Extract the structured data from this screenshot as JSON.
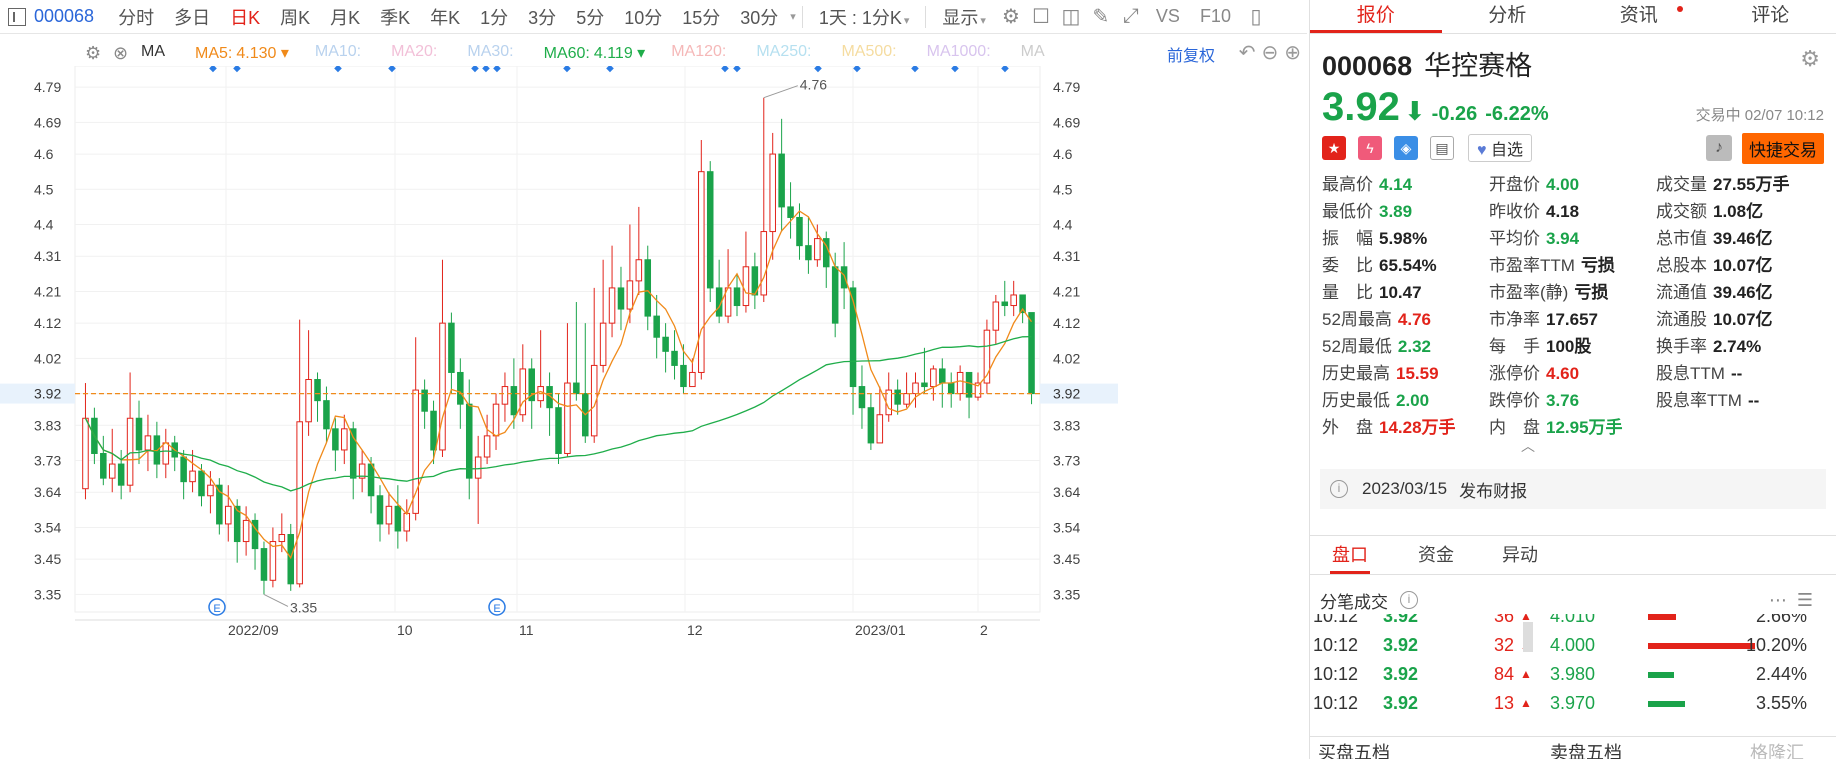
{
  "toolbar": {
    "code": "000068",
    "periods": [
      "分时",
      "多日",
      "日K",
      "周K",
      "月K",
      "季K",
      "年K",
      "1分",
      "3分",
      "5分",
      "10分",
      "15分",
      "30分"
    ],
    "active_period": "日K",
    "range": "1天 : 1分K",
    "display": "显示",
    "vs": "VS",
    "f10": "F10"
  },
  "mabar": {
    "ma_items": [
      {
        "label": "MA",
        "value": "",
        "color": "#333333"
      },
      {
        "label": "MA5:",
        "value": "4.130 ▾",
        "color": "#f08a1a"
      },
      {
        "label": "MA10:",
        "value": "",
        "color": "#b9d2ee"
      },
      {
        "label": "MA20:",
        "value": "",
        "color": "#f2c0d8"
      },
      {
        "label": "MA30:",
        "value": "",
        "color": "#b9d2ee"
      },
      {
        "label": "MA60:",
        "value": "4.119 ▾",
        "color": "#1fad4a"
      },
      {
        "label": "MA120:",
        "value": "",
        "color": "#f5b8b8"
      },
      {
        "label": "MA250:",
        "value": "",
        "color": "#b6e0f0"
      },
      {
        "label": "MA500:",
        "value": "",
        "color": "#f5dca0"
      },
      {
        "label": "MA1000:",
        "value": "",
        "color": "#d8c4ee"
      },
      {
        "label": "MA",
        "value": "",
        "color": "#cccccc"
      }
    ],
    "adjust": "前复权"
  },
  "chart_data": {
    "type": "candlestick",
    "x_labels": [
      "2022/09",
      "10",
      "11",
      "12",
      "2023/01",
      "2"
    ],
    "y_ticks": [
      4.79,
      4.69,
      4.6,
      4.5,
      4.4,
      4.31,
      4.21,
      4.12,
      4.02,
      3.92,
      3.83,
      3.73,
      3.64,
      3.54,
      3.45,
      3.35
    ],
    "ylim": [
      3.3,
      4.85
    ],
    "current_price": 3.92,
    "max_label": "4.76",
    "min_label": "3.35",
    "event_marker": "E",
    "candles": [
      [
        3.65,
        3.85,
        3.95,
        3.62
      ],
      [
        3.85,
        3.75,
        3.88,
        3.72
      ],
      [
        3.75,
        3.68,
        3.8,
        3.66
      ],
      [
        3.68,
        3.72,
        3.82,
        3.64
      ],
      [
        3.72,
        3.66,
        3.76,
        3.62
      ],
      [
        3.66,
        3.85,
        3.98,
        3.64
      ],
      [
        3.85,
        3.76,
        3.9,
        3.72
      ],
      [
        3.76,
        3.8,
        3.86,
        3.7
      ],
      [
        3.8,
        3.72,
        3.84,
        3.68
      ],
      [
        3.72,
        3.78,
        3.82,
        3.68
      ],
      [
        3.78,
        3.74,
        3.8,
        3.7
      ],
      [
        3.74,
        3.67,
        3.76,
        3.62
      ],
      [
        3.67,
        3.7,
        3.76,
        3.64
      ],
      [
        3.7,
        3.63,
        3.72,
        3.6
      ],
      [
        3.63,
        3.66,
        3.7,
        3.58
      ],
      [
        3.66,
        3.55,
        3.68,
        3.52
      ],
      [
        3.55,
        3.6,
        3.66,
        3.5
      ],
      [
        3.6,
        3.5,
        3.62,
        3.44
      ],
      [
        3.5,
        3.56,
        3.6,
        3.46
      ],
      [
        3.56,
        3.48,
        3.58,
        3.42
      ],
      [
        3.48,
        3.39,
        3.5,
        3.35
      ],
      [
        3.39,
        3.5,
        3.54,
        3.37
      ],
      [
        3.5,
        3.52,
        3.58,
        3.47
      ],
      [
        3.52,
        3.38,
        3.55,
        3.36
      ],
      [
        3.38,
        3.84,
        4.13,
        3.37
      ],
      [
        3.84,
        3.96,
        4.1,
        3.8
      ],
      [
        3.96,
        3.9,
        3.98,
        3.84
      ],
      [
        3.9,
        3.82,
        3.94,
        3.78
      ],
      [
        3.82,
        3.76,
        3.85,
        3.7
      ],
      [
        3.76,
        3.82,
        3.86,
        3.72
      ],
      [
        3.82,
        3.68,
        3.84,
        3.62
      ],
      [
        3.68,
        3.72,
        3.76,
        3.64
      ],
      [
        3.72,
        3.63,
        3.74,
        3.58
      ],
      [
        3.63,
        3.55,
        3.66,
        3.5
      ],
      [
        3.55,
        3.6,
        3.64,
        3.52
      ],
      [
        3.6,
        3.53,
        3.66,
        3.48
      ],
      [
        3.53,
        3.58,
        3.62,
        3.5
      ],
      [
        3.58,
        3.93,
        4.08,
        3.56
      ],
      [
        3.93,
        3.87,
        3.96,
        3.82
      ],
      [
        3.87,
        3.76,
        3.9,
        3.72
      ],
      [
        3.76,
        4.12,
        4.3,
        3.74
      ],
      [
        4.12,
        3.98,
        4.15,
        3.92
      ],
      [
        3.98,
        3.89,
        4.02,
        3.82
      ],
      [
        3.89,
        3.68,
        3.96,
        3.62
      ],
      [
        3.68,
        3.74,
        3.8,
        3.55
      ],
      [
        3.74,
        3.8,
        3.86,
        3.72
      ],
      [
        3.8,
        3.89,
        3.92,
        3.76
      ],
      [
        3.89,
        3.94,
        3.98,
        3.84
      ],
      [
        3.94,
        3.86,
        4.02,
        3.82
      ],
      [
        3.86,
        3.99,
        4.06,
        3.84
      ],
      [
        3.99,
        3.9,
        4.02,
        3.82
      ],
      [
        3.9,
        3.94,
        4.1,
        3.88
      ],
      [
        3.94,
        3.88,
        3.98,
        3.8
      ],
      [
        3.88,
        3.75,
        3.92,
        3.72
      ],
      [
        3.75,
        3.95,
        4.12,
        3.74
      ],
      [
        3.95,
        3.92,
        4.18,
        3.9
      ],
      [
        3.92,
        3.8,
        4.12,
        3.78
      ],
      [
        3.8,
        4.0,
        4.22,
        3.78
      ],
      [
        4.0,
        4.12,
        4.3,
        3.98
      ],
      [
        4.12,
        4.22,
        4.34,
        4.08
      ],
      [
        4.22,
        4.16,
        4.28,
        4.1
      ],
      [
        4.16,
        4.24,
        4.4,
        4.12
      ],
      [
        4.24,
        4.3,
        4.45,
        4.2
      ],
      [
        4.3,
        4.14,
        4.34,
        4.1
      ],
      [
        4.14,
        4.08,
        4.2,
        4.02
      ],
      [
        4.08,
        4.04,
        4.12,
        3.98
      ],
      [
        4.04,
        4.0,
        4.1,
        3.96
      ],
      [
        4.0,
        3.94,
        4.06,
        3.92
      ],
      [
        3.94,
        3.98,
        4.02,
        3.94
      ],
      [
        3.98,
        4.55,
        4.64,
        3.96
      ],
      [
        4.55,
        4.22,
        4.58,
        4.18
      ],
      [
        4.22,
        4.14,
        4.3,
        4.12
      ],
      [
        4.14,
        4.22,
        4.33,
        4.12
      ],
      [
        4.22,
        4.17,
        4.26,
        4.14
      ],
      [
        4.17,
        4.28,
        4.38,
        4.15
      ],
      [
        4.28,
        4.2,
        4.32,
        4.16
      ],
      [
        4.2,
        4.38,
        4.76,
        4.18
      ],
      [
        4.38,
        4.6,
        4.66,
        4.3
      ],
      [
        4.6,
        4.45,
        4.7,
        4.38
      ],
      [
        4.45,
        4.42,
        4.52,
        4.36
      ],
      [
        4.42,
        4.34,
        4.46,
        4.3
      ],
      [
        4.34,
        4.3,
        4.42,
        4.26
      ],
      [
        4.3,
        4.36,
        4.4,
        4.28
      ],
      [
        4.36,
        4.28,
        4.38,
        4.22
      ],
      [
        4.28,
        4.12,
        4.32,
        4.08
      ],
      [
        4.28,
        4.22,
        4.35,
        4.16
      ],
      [
        4.22,
        3.94,
        4.24,
        3.86
      ],
      [
        3.94,
        3.88,
        4.0,
        3.82
      ],
      [
        3.88,
        3.78,
        3.92,
        3.76
      ],
      [
        3.78,
        3.86,
        3.94,
        3.8
      ],
      [
        3.86,
        3.93,
        3.98,
        3.84
      ],
      [
        3.93,
        3.89,
        3.96,
        3.86
      ],
      [
        3.89,
        3.92,
        3.98,
        3.88
      ],
      [
        3.92,
        3.95,
        3.98,
        3.88
      ],
      [
        3.95,
        3.94,
        4.05,
        3.92
      ],
      [
        3.94,
        3.99,
        4.0,
        3.9
      ],
      [
        3.99,
        3.95,
        4.02,
        3.88
      ],
      [
        3.95,
        3.92,
        3.98,
        3.88
      ],
      [
        3.92,
        3.98,
        4.0,
        3.9
      ],
      [
        3.98,
        3.91,
        3.98,
        3.85
      ],
      [
        3.91,
        3.95,
        3.98,
        3.9
      ],
      [
        3.95,
        4.1,
        4.13,
        3.92
      ],
      [
        4.1,
        4.18,
        4.2,
        4.06
      ],
      [
        4.18,
        4.17,
        4.24,
        4.14
      ],
      [
        4.17,
        4.2,
        4.24,
        4.14
      ],
      [
        4.2,
        4.15,
        4.2,
        4.12
      ],
      [
        4.15,
        3.92,
        4.14,
        3.89
      ]
    ],
    "ma5_color": "#f08a1a",
    "ma60_color": "#1fad4a",
    "up_color": "#e2231a",
    "down_color": "#1aa34a"
  },
  "stock": {
    "code": "000068",
    "name": "华控赛格",
    "price": "3.92",
    "change": "-0.26",
    "change_pct": "-6.22%",
    "status": "交易中 02/07 10:12",
    "favorite": "自选",
    "quick_trade": "快捷交易"
  },
  "stats": [
    {
      "label": "最高价",
      "value": "4.14",
      "cls": "grn"
    },
    {
      "label": "开盘价",
      "value": "4.00",
      "cls": "grn"
    },
    {
      "label": "成交量",
      "value": "27.55万手",
      "cls": "blk"
    },
    {
      "label": "最低价",
      "value": "3.89",
      "cls": "grn"
    },
    {
      "label": "昨收价",
      "value": "4.18",
      "cls": "blk"
    },
    {
      "label": "成交额",
      "value": "1.08亿",
      "cls": "blk"
    },
    {
      "label": "振　幅",
      "value": "5.98%",
      "cls": "blk"
    },
    {
      "label": "平均价",
      "value": "3.94",
      "cls": "grn"
    },
    {
      "label": "总市值",
      "value": "39.46亿",
      "cls": "blk"
    },
    {
      "label": "委　比",
      "value": "65.54%",
      "cls": "blk"
    },
    {
      "label": "市盈率TTM",
      "value": "亏损",
      "cls": "blk"
    },
    {
      "label": "总股本",
      "value": "10.07亿",
      "cls": "blk"
    },
    {
      "label": "量　比",
      "value": "10.47",
      "cls": "blk"
    },
    {
      "label": "市盈率(静)",
      "value": "亏损",
      "cls": "blk"
    },
    {
      "label": "流通值",
      "value": "39.46亿",
      "cls": "blk"
    },
    {
      "label": "52周最高",
      "value": "4.76",
      "cls": "red"
    },
    {
      "label": "市净率",
      "value": "17.657",
      "cls": "blk"
    },
    {
      "label": "流通股",
      "value": "10.07亿",
      "cls": "blk"
    },
    {
      "label": "52周最低",
      "value": "2.32",
      "cls": "grn"
    },
    {
      "label": "每　手",
      "value": "100股",
      "cls": "blk"
    },
    {
      "label": "换手率",
      "value": "2.74%",
      "cls": "blk"
    },
    {
      "label": "历史最高",
      "value": "15.59",
      "cls": "red"
    },
    {
      "label": "涨停价",
      "value": "4.60",
      "cls": "red"
    },
    {
      "label": "股息TTM",
      "value": "--",
      "cls": "blk"
    },
    {
      "label": "历史最低",
      "value": "2.00",
      "cls": "grn"
    },
    {
      "label": "跌停价",
      "value": "3.76",
      "cls": "grn"
    },
    {
      "label": "股息率TTM",
      "value": "--",
      "cls": "blk"
    },
    {
      "label": "外　盘",
      "value": "14.28万手",
      "cls": "red"
    },
    {
      "label": "内　盘",
      "value": "12.95万手",
      "cls": "grn"
    },
    {
      "label": "",
      "value": "",
      "cls": "blk"
    }
  ],
  "report": {
    "date": "2023/03/15",
    "text": "发布财报"
  },
  "rtabs": [
    "报价",
    "分析",
    "资讯",
    "评论"
  ],
  "subtabs": [
    "盘口",
    "资金",
    "异动"
  ],
  "ticks_title": "分笔成交",
  "ticks": [
    {
      "time": "10:12",
      "price": "3.92",
      "qty": "36"
    },
    {
      "time": "10:12",
      "price": "3.92",
      "qty": "32"
    },
    {
      "time": "10:12",
      "price": "3.92",
      "qty": "84"
    },
    {
      "time": "10:12",
      "price": "3.92",
      "qty": "13"
    }
  ],
  "depth": [
    {
      "price": "4.010",
      "pct": "2.66%",
      "level": 0.0266
    },
    {
      "price": "4.000",
      "pct": "10.20%",
      "level": 0.102
    },
    {
      "price": "3.980",
      "pct": "2.44%",
      "level": 0.0244
    },
    {
      "price": "3.970",
      "pct": "3.55%",
      "level": 0.0355
    }
  ],
  "bottom": {
    "buy": "买盘五档",
    "sell": "卖盘五档",
    "tag": "格隆汇"
  }
}
